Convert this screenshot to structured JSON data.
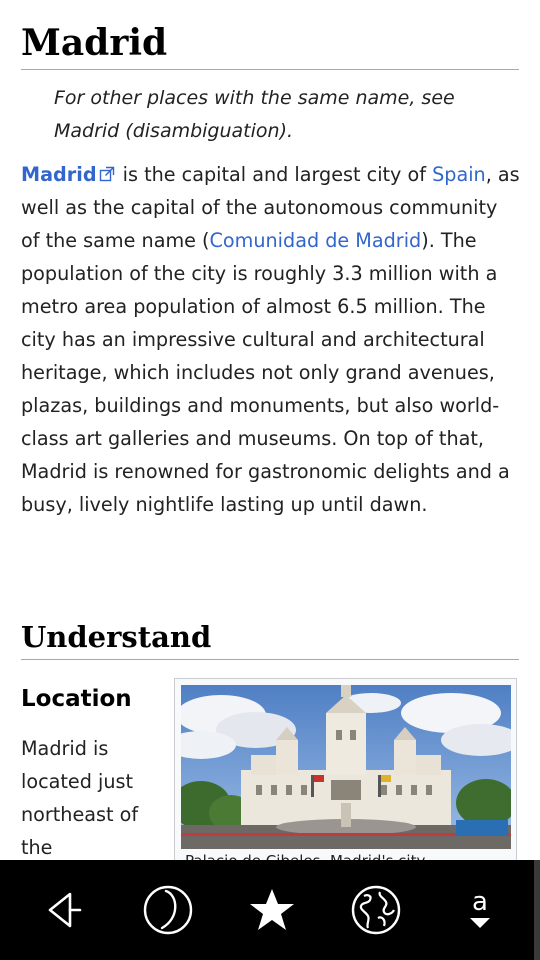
{
  "article": {
    "title": "Madrid",
    "hatnote": "For other places with the same name, see Madrid (disambiguation).",
    "intro": {
      "link_madrid": "Madrid",
      "text_1": " is the capital and largest city of ",
      "link_spain": "Spain",
      "text_2": ", as well as the capital of the autonomous community of the same name (",
      "link_comunidad": "Comunidad de Madrid",
      "text_3": "). The population of the city is roughly 3.3 million with a metro area population of almost 6.5 million. The city has an impressive cultural and architectural heritage, which includes not only grand avenues, plazas, buildings and monuments, but also world-class art galleries and museums. On top of that, Madrid is renowned for gastronomic delights and a busy, lively nightlife lasting up until dawn."
    },
    "section_understand": "Understand",
    "subsection_location": "Location",
    "location_text": "Madrid is located just northeast of the",
    "thumb_caption": "Palacio de Cibeles, Madrid's city"
  },
  "toolbar": {
    "buttons": [
      {
        "icon": "back-icon",
        "label": "Back"
      },
      {
        "icon": "moon-icon",
        "label": "Night mode"
      },
      {
        "icon": "star-icon",
        "label": "Bookmarks"
      },
      {
        "icon": "globe-icon",
        "label": "Map"
      },
      {
        "icon": "font-size-icon",
        "label": "Text size"
      }
    ]
  },
  "colors": {
    "link": "#3366cc",
    "text": "#222222",
    "toolbar_bg": "#000000",
    "rule": "#a2a9b1"
  }
}
